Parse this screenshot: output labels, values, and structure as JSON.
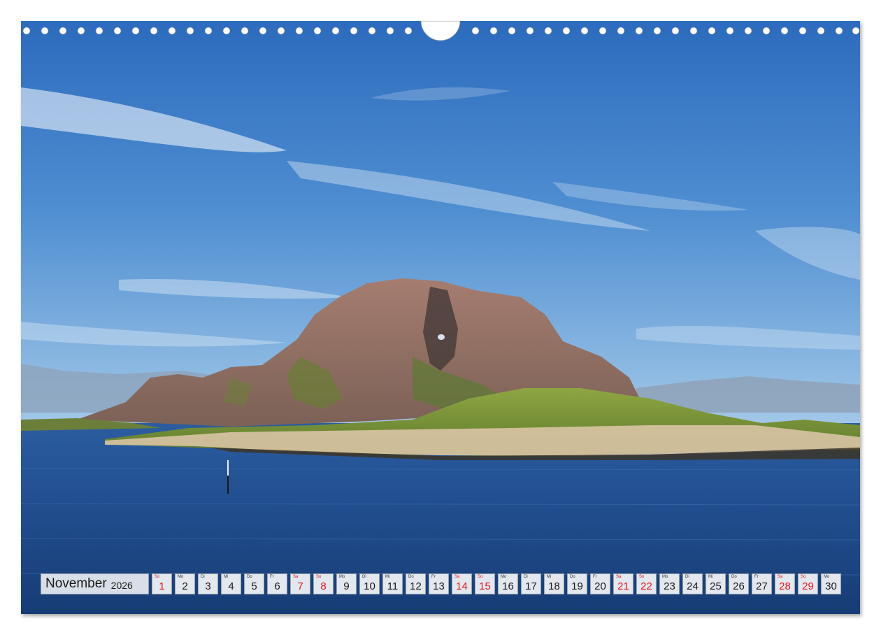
{
  "calendar": {
    "month": "November",
    "year": "2026",
    "holiday_color": "#e0161b",
    "days": [
      {
        "d": "1",
        "w": "So",
        "t": "sun"
      },
      {
        "d": "2",
        "w": "Mo",
        "t": ""
      },
      {
        "d": "3",
        "w": "Di",
        "t": ""
      },
      {
        "d": "4",
        "w": "Mi",
        "t": ""
      },
      {
        "d": "5",
        "w": "Do",
        "t": ""
      },
      {
        "d": "6",
        "w": "Fr",
        "t": ""
      },
      {
        "d": "7",
        "w": "Sa",
        "t": "sat"
      },
      {
        "d": "8",
        "w": "So",
        "t": "sun"
      },
      {
        "d": "9",
        "w": "Mo",
        "t": ""
      },
      {
        "d": "10",
        "w": "Di",
        "t": ""
      },
      {
        "d": "11",
        "w": "Mi",
        "t": ""
      },
      {
        "d": "12",
        "w": "Do",
        "t": ""
      },
      {
        "d": "13",
        "w": "Fr",
        "t": ""
      },
      {
        "d": "14",
        "w": "Sa",
        "t": "sat"
      },
      {
        "d": "15",
        "w": "So",
        "t": "sun"
      },
      {
        "d": "16",
        "w": "Mo",
        "t": ""
      },
      {
        "d": "17",
        "w": "Di",
        "t": ""
      },
      {
        "d": "18",
        "w": "Mi",
        "t": ""
      },
      {
        "d": "19",
        "w": "Do",
        "t": ""
      },
      {
        "d": "20",
        "w": "Fr",
        "t": ""
      },
      {
        "d": "21",
        "w": "Sa",
        "t": "sat"
      },
      {
        "d": "22",
        "w": "So",
        "t": "sun"
      },
      {
        "d": "23",
        "w": "Mo",
        "t": ""
      },
      {
        "d": "24",
        "w": "Di",
        "t": ""
      },
      {
        "d": "25",
        "w": "Mi",
        "t": ""
      },
      {
        "d": "26",
        "w": "Do",
        "t": ""
      },
      {
        "d": "27",
        "w": "Fr",
        "t": ""
      },
      {
        "d": "28",
        "w": "Sa",
        "t": "sat"
      },
      {
        "d": "29",
        "w": "So",
        "t": "sun"
      },
      {
        "d": "30",
        "w": "Mo",
        "t": ""
      }
    ]
  },
  "photo": {
    "subject": "mountain-with-hole-island-landscape",
    "colors": {
      "sky_top": "#2f6fbf",
      "sky_mid": "#4f8fd0",
      "sky_horizon": "#9cc4e6",
      "rock": "#9a7468",
      "grass": "#7f9a3a",
      "sea": "#1f4a8a"
    }
  }
}
